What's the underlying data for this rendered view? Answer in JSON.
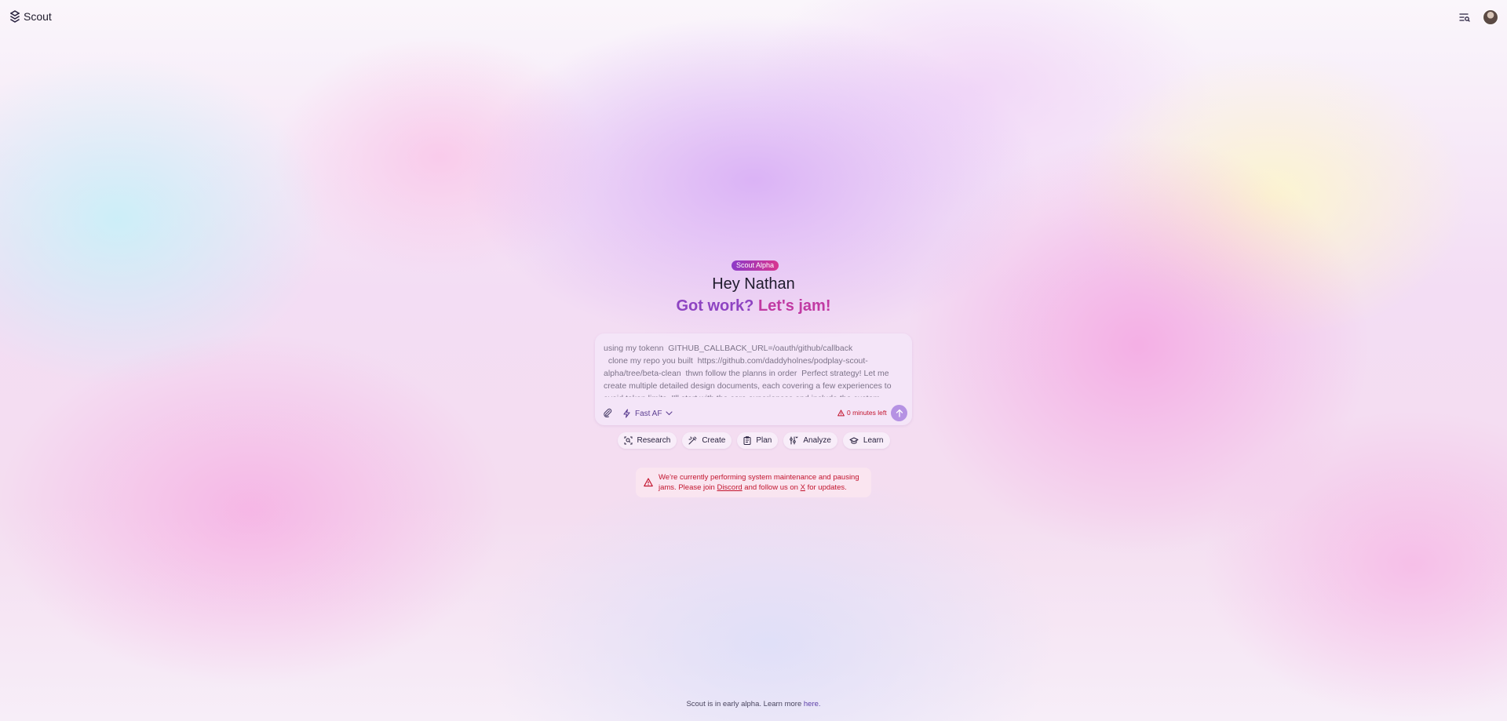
{
  "app": {
    "name": "Scout"
  },
  "header": {
    "menu_icon": "menu-search-icon",
    "avatar_alt": "user-avatar"
  },
  "hero": {
    "badge": "Scout Alpha",
    "greeting": "Hey Nathan",
    "tagline_part1": "Got work? ",
    "tagline_part2": "Let's jam!"
  },
  "composer": {
    "value": "using my tokenn  GITHUB_CALLBACK_URL=/oauth/github/callback\n  clone my repo you built  https://github.com/daddyholnes/podplay-scout-alpha/tree/beta-clean  thwn follow the planns in order  Perfect strategy! Let me create multiple detailed design documents, each covering a few experiences to avoid token limits. I'll start with the core experiences and include the custom theme",
    "model_label": "Fast AF",
    "time_left": "0 minutes left",
    "colors": {
      "send": "#b592e3",
      "warning": "#c2152e"
    }
  },
  "quick_actions": [
    {
      "label": "Research",
      "icon": "research-icon"
    },
    {
      "label": "Create",
      "icon": "create-icon"
    },
    {
      "label": "Plan",
      "icon": "plan-icon"
    },
    {
      "label": "Analyze",
      "icon": "analyze-icon"
    },
    {
      "label": "Learn",
      "icon": "learn-icon"
    }
  ],
  "alert": {
    "line1": "We're currently performing system maintenance and pausing",
    "line2_before": "jams. Please join ",
    "discord": "Discord",
    "line2_middle": " and follow us on ",
    "x": "X",
    "line2_after": " for updates."
  },
  "footer": {
    "text": "Scout is in early alpha. Learn more ",
    "link": "here."
  }
}
